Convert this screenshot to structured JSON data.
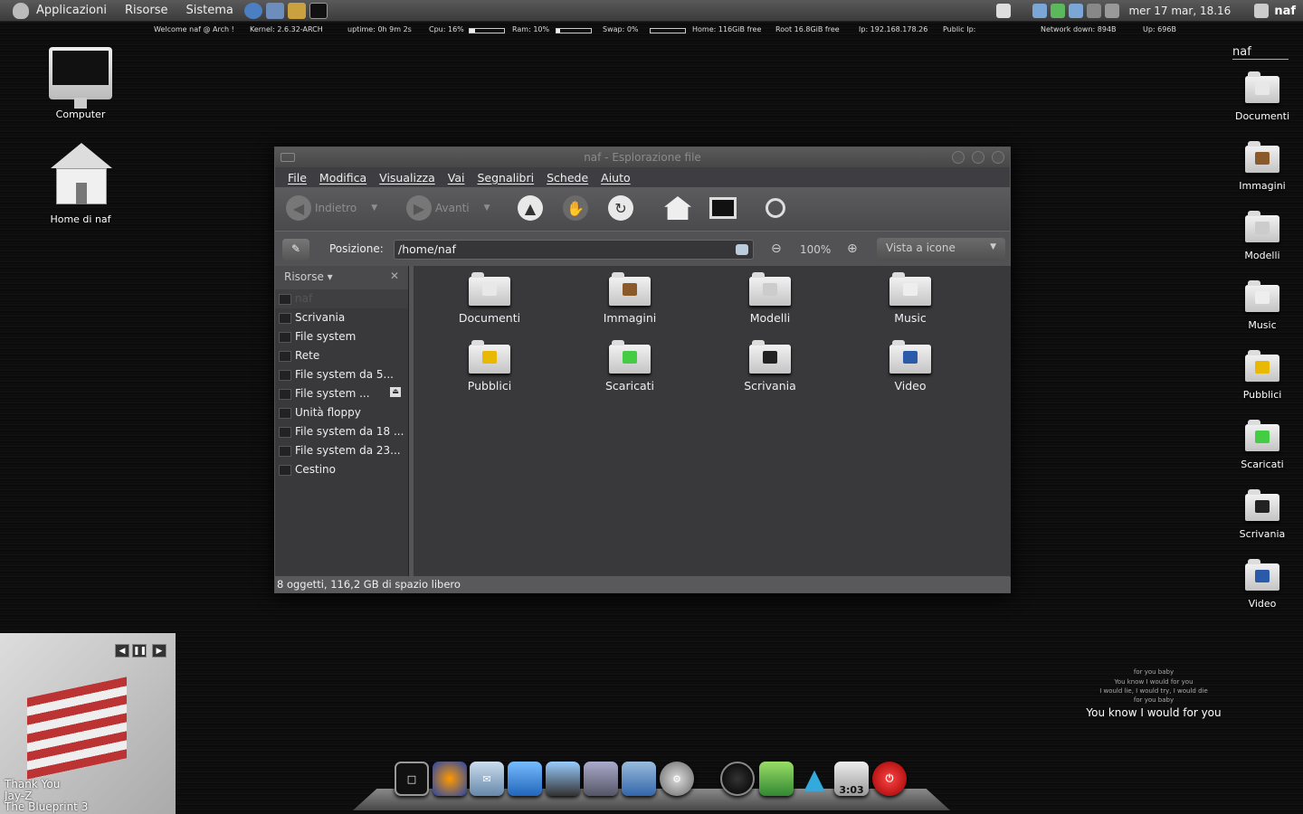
{
  "panel": {
    "menus": [
      "Applicazioni",
      "Risorse",
      "Sistema"
    ],
    "clock": "mer 17 mar, 18.16",
    "user": "naf"
  },
  "conky": {
    "welcome": "Welcome naf @ Arch !",
    "kernel": "Kernel: 2.6.32-ARCH",
    "uptime": "uptime: 0h 9m 2s",
    "cpu": "Cpu: 16%",
    "cpu_pct": 16,
    "ram": "Ram: 10%",
    "ram_pct": 10,
    "swap": "Swap: 0%",
    "swap_pct": 0,
    "home": "Home: 116GiB free",
    "root": "Root 16.8GiB free",
    "ip": "Ip: 192.168.178.26",
    "public_ip": "Public Ip:",
    "net_down": "Network down: 894B",
    "net_up": "Up: 696B"
  },
  "desktop_left": [
    {
      "label": "Computer",
      "icon": "monitor-icon"
    },
    {
      "label": "Home di naf",
      "icon": "house-icon"
    }
  ],
  "desktop_right": {
    "header": "naf",
    "items": [
      "Documenti",
      "Immagini",
      "Modelli",
      "Music",
      "Pubblici",
      "Scaricati",
      "Scrivania",
      "Video"
    ]
  },
  "window": {
    "title": "naf - Esplorazione file",
    "menus": [
      "File",
      "Modifica",
      "Visualizza",
      "Vai",
      "Segnalibri",
      "Schede",
      "Aiuto"
    ],
    "toolbar": {
      "back": "Indietro",
      "forward": "Avanti"
    },
    "location": {
      "label": "Posizione:",
      "path": "/home/naf",
      "zoom": "100%",
      "view": "Vista a icone"
    },
    "sidebar": {
      "header": "Risorse",
      "items": [
        "naf",
        "Scrivania",
        "File system",
        "Rete",
        "File system da 5...",
        "File system ...",
        "Unità floppy",
        "File system da 18 ...",
        "File system da 23...",
        "Cestino"
      ]
    },
    "files": [
      "Documenti",
      "Immagini",
      "Modelli",
      "Music",
      "Pubblici",
      "Scaricati",
      "Scrivania",
      "Video"
    ],
    "status": "8 oggetti, 116,2 GB di spazio libero"
  },
  "player": {
    "title": "Thank You",
    "artist": "Jay-Z",
    "album": "The Blueprint 3"
  },
  "lyrics": {
    "lines": [
      "for you baby",
      "You know I would for you",
      "I would lie, I would try, I would die",
      "for you baby"
    ],
    "current": "You know I would for you"
  },
  "dock": {
    "clock": "3:03"
  }
}
